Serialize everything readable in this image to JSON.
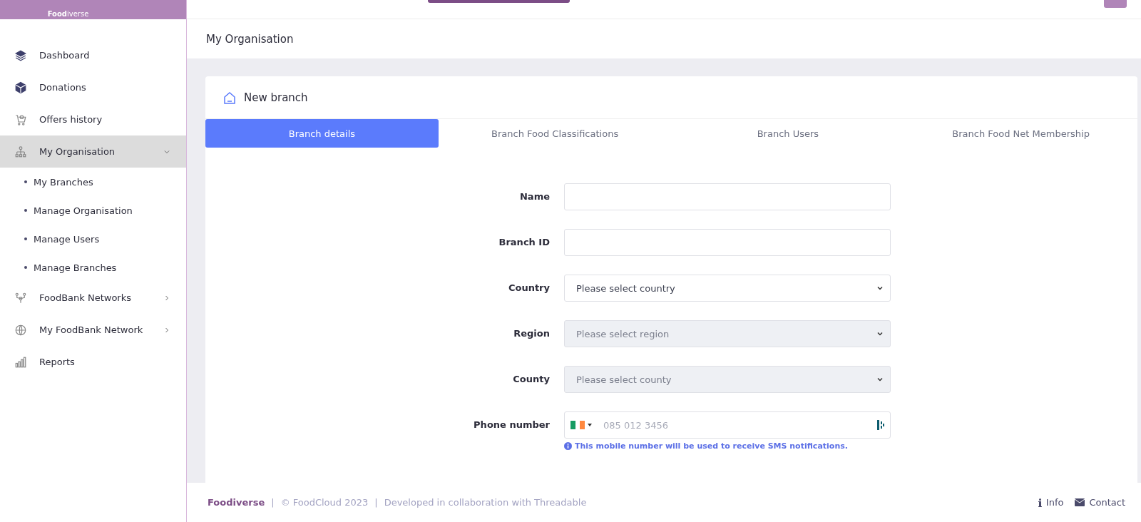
{
  "logo": {
    "text": "**Food**iverse"
  },
  "sidebar": {
    "items": [
      {
        "label": "Dashboard",
        "selected": false
      },
      {
        "label": "Donations",
        "selected": false
      },
      {
        "label": "Offers history",
        "selected": false
      },
      {
        "label": "My Organisation",
        "selected": true,
        "expanded": true,
        "children": [
          {
            "label": "My Branches"
          },
          {
            "label": "Manage Organisation"
          },
          {
            "label": "Manage Users"
          },
          {
            "label": "Manage Branches"
          }
        ]
      },
      {
        "label": "FoodBank Networks",
        "selected": false,
        "expanded": false
      },
      {
        "label": "My FoodBank Network",
        "selected": false,
        "expanded": false
      },
      {
        "label": "Reports",
        "selected": false
      }
    ]
  },
  "page_title": "My Organisation",
  "card": {
    "title": "New branch",
    "tabs": [
      {
        "label": "Branch details",
        "selected": true
      },
      {
        "label": "Branch Food Classifications",
        "selected": false
      },
      {
        "label": "Branch Users",
        "selected": false
      },
      {
        "label": "Branch Food Net Membership",
        "selected": false
      }
    ],
    "fields": [
      {
        "kind": "text",
        "label": "Name"
      },
      {
        "kind": "text",
        "label": "Branch ID"
      },
      {
        "kind": "select",
        "label": "Country",
        "placeholder": "Please select country",
        "disabled": false
      },
      {
        "kind": "select",
        "label": "Region",
        "placeholder": "Please select region",
        "disabled": true
      },
      {
        "kind": "select",
        "label": "County",
        "placeholder": "Please select county",
        "disabled": true
      },
      {
        "kind": "phone",
        "label": "Phone number",
        "placeholder": "085 012 3456",
        "hint": "This mobile number will be used to receive SMS notifications."
      }
    ]
  },
  "footer": {
    "parts": [
      {
        "kind": "brand",
        "text": "Foodiverse"
      },
      {
        "kind": "separator",
        "text": "|"
      },
      {
        "kind": "text",
        "text": "© FoodCloud 2023"
      },
      {
        "kind": "separator",
        "text": "|"
      },
      {
        "kind": "text",
        "text": "Developed in collaboration with Threadable"
      }
    ],
    "links": [
      {
        "label": "Info"
      },
      {
        "label": "Contact"
      }
    ]
  }
}
